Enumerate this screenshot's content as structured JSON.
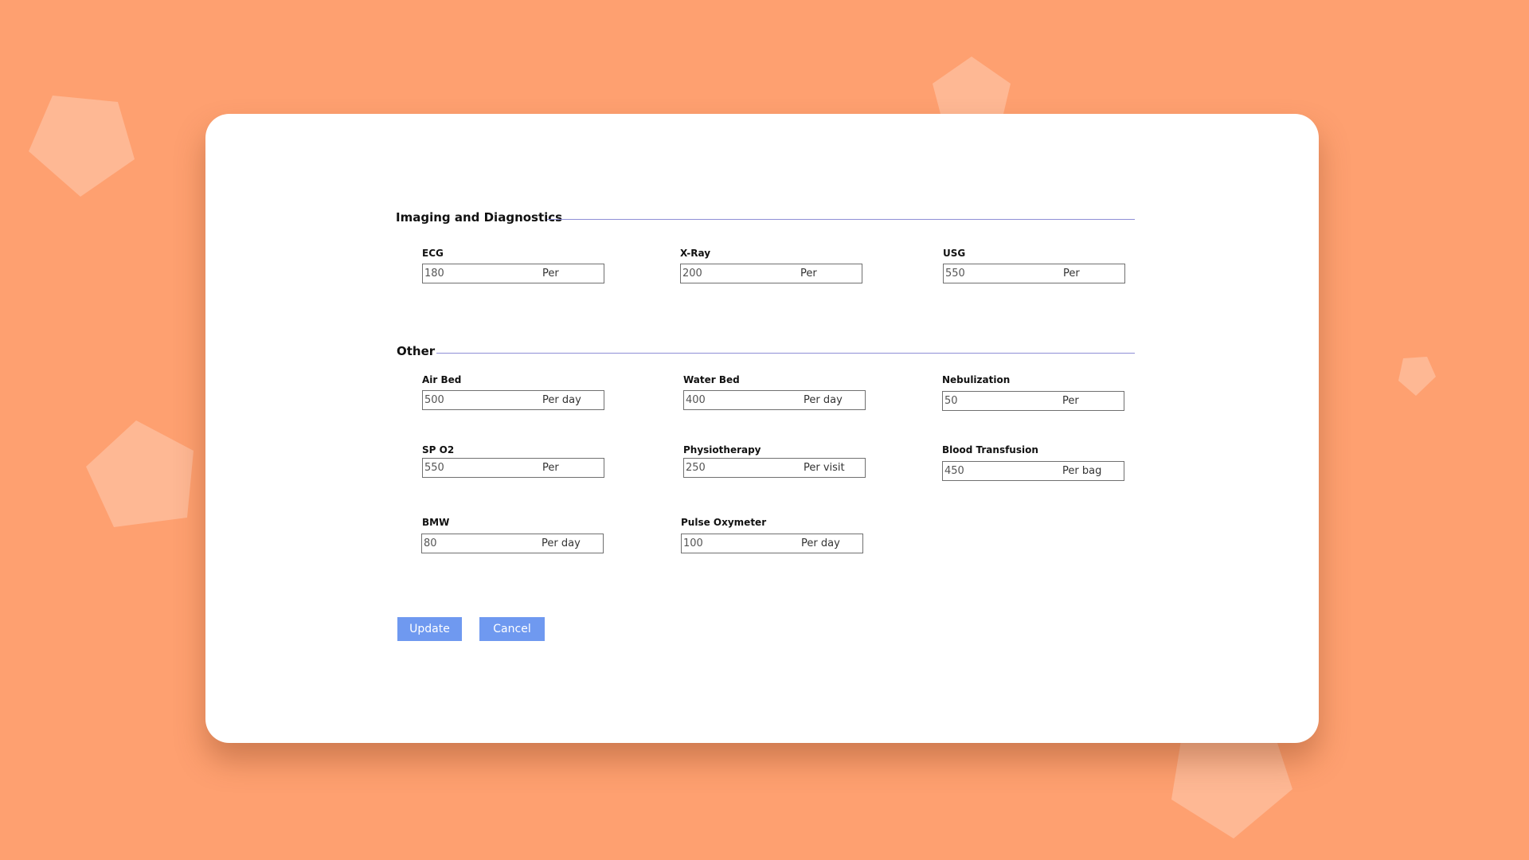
{
  "theme": {
    "background": "#fea070",
    "card": "#ffffff",
    "accent_rule": "#8f8fd6",
    "button": "#6f99f0"
  },
  "sections": [
    {
      "title": "Imaging and Diagnostics",
      "fields": [
        {
          "label": "ECG",
          "value": "180",
          "unit": "Per"
        },
        {
          "label": "X-Ray",
          "value": "200",
          "unit": "Per"
        },
        {
          "label": "USG",
          "value": "550",
          "unit": "Per"
        }
      ]
    },
    {
      "title": "Other",
      "fields": [
        {
          "label": "Air Bed",
          "value": "500",
          "unit": "Per day"
        },
        {
          "label": "Water Bed",
          "value": "400",
          "unit": "Per day"
        },
        {
          "label": "Nebulization",
          "value": "50",
          "unit": "Per"
        },
        {
          "label": "SP O2",
          "value": "550",
          "unit": "Per"
        },
        {
          "label": "Physiotherapy",
          "value": "250",
          "unit": "Per visit"
        },
        {
          "label": "Blood Transfusion",
          "value": "450",
          "unit": "Per bag"
        },
        {
          "label": "BMW",
          "value": "80",
          "unit": "Per day"
        },
        {
          "label": "Pulse Oxymeter",
          "value": "100",
          "unit": "Per day"
        }
      ]
    }
  ],
  "actions": {
    "update_label": "Update",
    "cancel_label": "Cancel"
  }
}
